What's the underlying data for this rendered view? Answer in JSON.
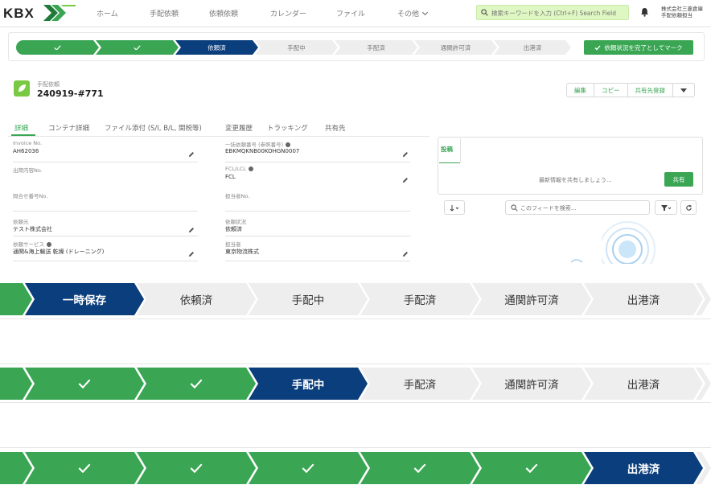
{
  "nav": {
    "logo_text": "KBX",
    "items": [
      "ホーム",
      "手配依頼",
      "依頼依頼",
      "カレンダー",
      "ファイル",
      "その他"
    ],
    "search_placeholder": "検索キーワードを入力 (Ctrl+F) Search Field",
    "user_line1": "株式会社三菱倉庫",
    "user_line2": "手配依頼担当"
  },
  "mini_path": {
    "steps": [
      {
        "label": "",
        "state": "done"
      },
      {
        "label": "",
        "state": "done"
      },
      {
        "label": "依頼済",
        "state": "cur"
      },
      {
        "label": "手配中",
        "state": "todo"
      },
      {
        "label": "手配済",
        "state": "todo"
      },
      {
        "label": "通関許可済",
        "state": "todo"
      },
      {
        "label": "出港済",
        "state": "todo"
      }
    ],
    "mark_button": "依頼状況を完了としてマーク"
  },
  "record": {
    "type_label": "手配依頼",
    "title": "240919-#771",
    "buttons": [
      "編集",
      "コピー",
      "共有先登録"
    ]
  },
  "tabs": [
    "詳細",
    "コンテナ詳細",
    "ファイル添付 (S/I, B/L, 関税等)",
    "変更履歴",
    "トラッキング",
    "共有先"
  ],
  "fields": {
    "invoice": {
      "label": "Invoice No.",
      "value": "AH62036"
    },
    "booking": {
      "label": "一括依頼番号 (参照番号)",
      "value": "EBKMQKNB00KOHGN0007"
    },
    "shipping": {
      "label": "出荷内容No.",
      "value": ""
    },
    "incoterms": {
      "label": "FCL/LCL",
      "value": "FCL"
    },
    "inquiry": {
      "label": "問合せ番号No.",
      "value": ""
    },
    "contact": {
      "label": "担当者No.",
      "value": ""
    },
    "owner": {
      "label": "依頼元",
      "value": "テスト株式会社"
    },
    "status": {
      "label": "依頼状況",
      "value": "依頼済"
    },
    "service": {
      "label": "依頼サービス",
      "value": "通関&海上輸送 乾燥 (ドレーニング)"
    },
    "forwarder": {
      "label": "担当者",
      "value": "東京物流株式"
    }
  },
  "chatter": {
    "tab": "投稿",
    "prompt": "最新情報を共有しましょう...",
    "share_button": "共有",
    "feed_search_placeholder": "このフィードを検索..."
  },
  "big_paths": [
    {
      "steps": [
        {
          "label": "",
          "state": "done"
        },
        {
          "label": "一時保存",
          "state": "cur"
        },
        {
          "label": "依頼済",
          "state": "todo"
        },
        {
          "label": "手配中",
          "state": "todo"
        },
        {
          "label": "手配済",
          "state": "todo"
        },
        {
          "label": "通関許可済",
          "state": "todo"
        },
        {
          "label": "出港済",
          "state": "todo"
        },
        {
          "label": "",
          "state": "todo"
        }
      ]
    },
    {
      "steps": [
        {
          "label": "",
          "state": "done"
        },
        {
          "label": "",
          "state": "done",
          "check": true
        },
        {
          "label": "",
          "state": "done",
          "check": true
        },
        {
          "label": "手配中",
          "state": "cur"
        },
        {
          "label": "手配済",
          "state": "todo"
        },
        {
          "label": "通関許可済",
          "state": "todo"
        },
        {
          "label": "出港済",
          "state": "todo"
        },
        {
          "label": "",
          "state": "todo"
        }
      ]
    },
    {
      "steps": [
        {
          "label": "",
          "state": "done"
        },
        {
          "label": "",
          "state": "done",
          "check": true
        },
        {
          "label": "",
          "state": "done",
          "check": true
        },
        {
          "label": "",
          "state": "done",
          "check": true
        },
        {
          "label": "",
          "state": "done",
          "check": true
        },
        {
          "label": "",
          "state": "done",
          "check": true
        },
        {
          "label": "出港済",
          "state": "cur"
        },
        {
          "label": "",
          "state": "todo"
        }
      ]
    }
  ],
  "colors": {
    "done": "#3aa654",
    "current": "#0b3e7c",
    "todo": "#eeeeee",
    "search_bg": "#dff7c2"
  }
}
